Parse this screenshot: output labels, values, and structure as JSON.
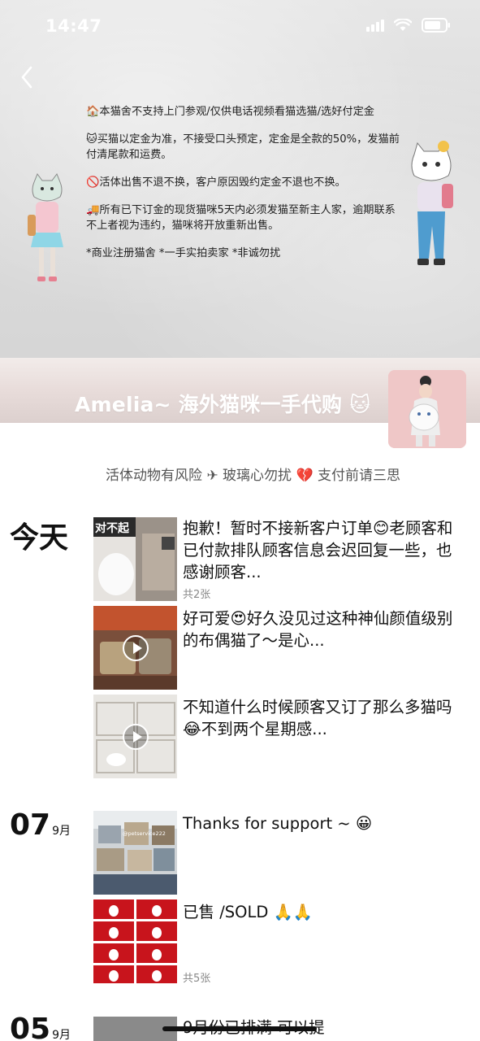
{
  "status_bar": {
    "time": "14:47"
  },
  "cover": {
    "notice_lines": [
      "🏠本猫舍不支持上门参观/仅供电话视频看猫选猫/选好付定金",
      "🐱买猫以定金为准，不接受口头预定，定金是全款的50%，发猫前付清尾款和运费。",
      "🚫活体出售不退不换，客户原因毁约定金不退也不换。",
      "🚚所有已下订金的现货猫咪5天内必须发猫至新主人家，逾期联系不上者视为违约，猫咪将开放重新出售。",
      "*商业注册猫舍 *一手实拍卖家 *非诚勿扰"
    ]
  },
  "profile": {
    "name": "Amelia~ 海外猫咪一手代购 🐱",
    "signature": "活体动物有风险 ✈  玻璃心勿扰 💔 支付前请三思"
  },
  "feed": [
    {
      "date_label": "今天",
      "posts": [
        {
          "text": "抱歉！暂时不接新客户订单😊老顾客和已付款排队顾客信息会迟回复一些，也感谢顾客...",
          "thumb_label": "对不起",
          "image_count": "共2张"
        },
        {
          "text": "好可爱😍好久没见过这种神仙颜值级别的布偶猫了～是心...",
          "video": true
        },
        {
          "text": "不知道什么时候顾客又订了那么多猫吗😂不到两个星期感...",
          "video": true
        }
      ]
    },
    {
      "date_day": "07",
      "date_month": "9月",
      "posts": [
        {
          "text": "Thanks for support ~ 😀",
          "watermark": "@petservice222"
        },
        {
          "text": "已售 /SOLD 🙏🙏",
          "image_count": "共5张"
        }
      ]
    },
    {
      "date_day": "05",
      "date_month": "9月",
      "posts": [
        {
          "text": "9月份已排满 可以提"
        }
      ]
    }
  ],
  "colors": {
    "cover_bg": "#dcdcdc",
    "name_band": "#e8dcda",
    "avatar_bg": "#efc7c7",
    "sold_red": "#c8141c"
  }
}
